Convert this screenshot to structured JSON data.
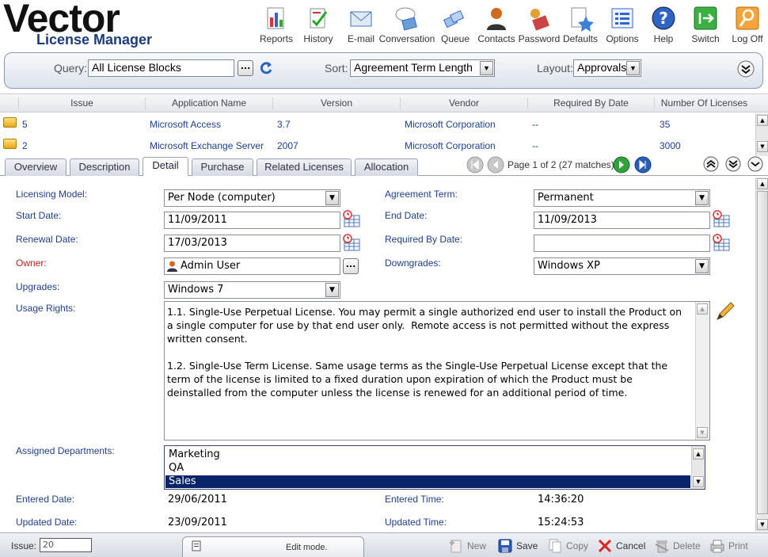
{
  "app": {
    "title": "Vector",
    "subtitle": "License Manager"
  },
  "toolbar": [
    {
      "label": "Reports",
      "icon": "reports-icon"
    },
    {
      "label": "History",
      "icon": "history-icon"
    },
    {
      "label": "E-mail",
      "icon": "email-icon"
    },
    {
      "label": "Conversation",
      "icon": "conversation-icon"
    },
    {
      "label": "Queue",
      "icon": "queue-icon"
    },
    {
      "label": "Contacts",
      "icon": "contacts-icon"
    },
    {
      "label": "Password",
      "icon": "password-icon"
    },
    {
      "label": "Defaults",
      "icon": "defaults-icon"
    },
    {
      "label": "Options",
      "icon": "options-icon"
    },
    {
      "label": "Help",
      "icon": "help-icon"
    },
    {
      "label": "Switch",
      "icon": "switch-icon"
    },
    {
      "label": "Log Off",
      "icon": "logoff-icon"
    }
  ],
  "query": {
    "query_label": "Query:",
    "query_value": "All License Blocks",
    "browse": "...",
    "sort_label": "Sort:",
    "sort_value": "Agreement Term Length",
    "layout_label": "Layout:",
    "layout_value": "Approvals"
  },
  "grid": {
    "columns": [
      "Issue",
      "Application Name",
      "Version",
      "Vendor",
      "Required By Date",
      "Number Of Licenses"
    ],
    "rows": [
      {
        "issue": "5",
        "app": "Microsoft Access",
        "version": "3.7",
        "vendor": "Microsoft Corporation",
        "required": "--",
        "count": "35"
      },
      {
        "issue": "2",
        "app": "Microsoft Exchange Server",
        "version": "2007",
        "vendor": "Microsoft Corporation",
        "required": "--",
        "count": "3000"
      }
    ]
  },
  "tabs": [
    "Overview",
    "Description",
    "Detail",
    "Purchase",
    "Related Licenses",
    "Allocation"
  ],
  "active_tab": "Detail",
  "pager": "Page 1 of 2 (27 matches)",
  "form": {
    "licensing_model_label": "Licensing Model:",
    "licensing_model": "Per Node (computer)",
    "start_date_label": "Start Date:",
    "start_date": "11/09/2011",
    "renewal_date_label": "Renewal Date:",
    "renewal_date": "17/03/2013",
    "owner_label": "Owner:",
    "owner": "Admin User",
    "owner_browse": "...",
    "upgrades_label": "Upgrades:",
    "upgrades": "Windows 7",
    "usage_rights_label": "Usage Rights:",
    "agreement_term_label": "Agreement Term:",
    "agreement_term": "Permanent",
    "end_date_label": "End Date:",
    "end_date": "11/09/2013",
    "required_by_label": "Required By Date:",
    "required_by": "",
    "downgrades_label": "Downgrades:",
    "downgrades": "Windows XP",
    "usage_rights": [
      "1.1. Single-Use Perpetual License. You may permit a single authorized end user to install the Product on a single computer for use by that end user only.  Remote access is not permitted without the express written consent.",
      "1.2. Single-Use Term License. Same usage terms as the Single-Use Perpetual License except that the term of the license is limited to a fixed duration upon expiration of which the Product must be deinstalled from the computer unless the license is renewed for an additional period of time."
    ],
    "assigned_departments_label": "Assigned Departments:",
    "departments": [
      "Marketing",
      "QA",
      "Sales"
    ],
    "selected_department": "Sales",
    "entered_date_label": "Entered Date:",
    "entered_date": "29/06/2011",
    "entered_time_label": "Entered Time:",
    "entered_time": "14:36:20",
    "updated_date_label": "Updated Date:",
    "updated_date": "23/09/2011",
    "updated_time_label": "Updated Time:",
    "updated_time": "15:24:53"
  },
  "statusbar": {
    "issue_label": "Issue:",
    "issue_value": "20",
    "mode": "Edit mode.",
    "actions": [
      "New",
      "Save",
      "Copy",
      "Cancel",
      "Delete",
      "Print"
    ]
  },
  "colors": {
    "link_blue": "#1b3f8f",
    "label_blue": "#1d3f86",
    "owner_red": "#b22222",
    "selection": "#0a246a"
  }
}
